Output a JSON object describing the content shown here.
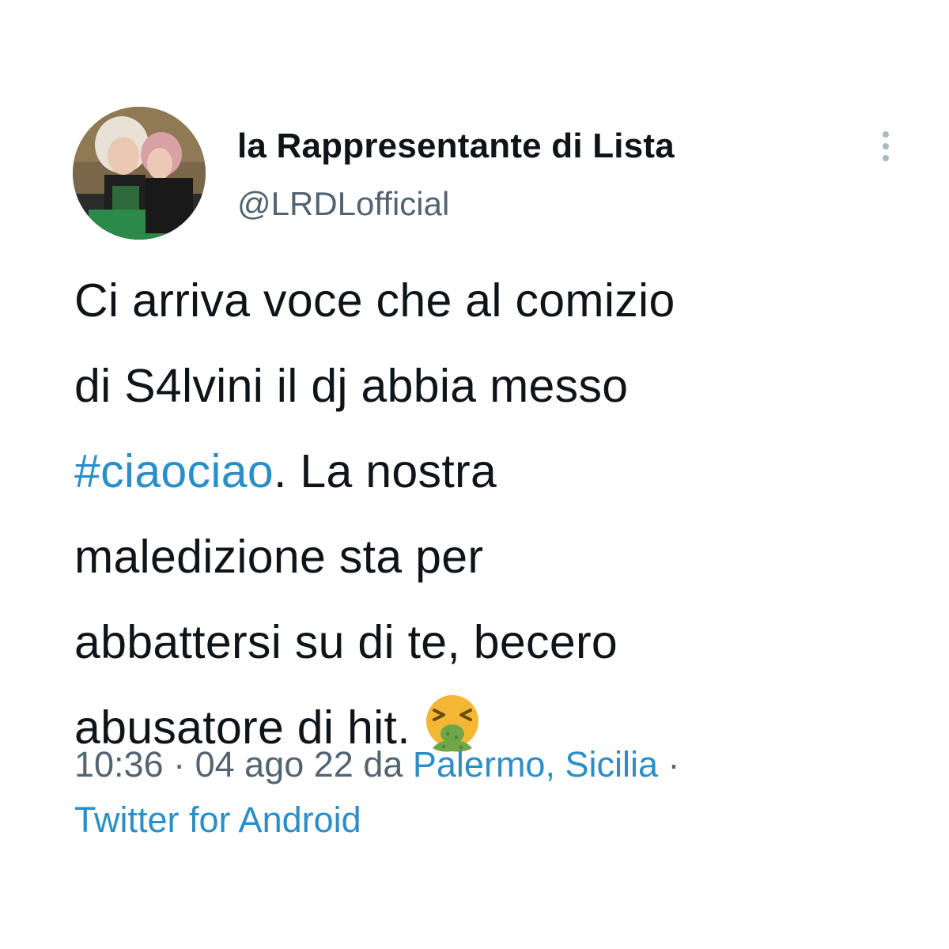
{
  "tweet": {
    "author": {
      "display_name": "la Rappresentante di Lista",
      "handle": "@LRDLofficial",
      "avatar_icon": "profile-photo"
    },
    "more_icon": "vertical-ellipsis-icon",
    "body": {
      "line1": "Ci arriva voce che al comizio",
      "line2": "di S4lvini il dj abbia messo",
      "hashtag": "#ciaociao",
      "line3_rest": ". La nostra",
      "line4": "maledizione sta per",
      "line5": "abbattersi su di te, becero",
      "line6": "abusatore di hit.",
      "emoji": "face-vomiting-emoji"
    },
    "meta": {
      "time": "10:36",
      "separator": " · ",
      "date": "04 ago 22",
      "from": " da ",
      "location": "Palermo, Sicilia",
      "separator_end": " ·",
      "source": "Twitter for Android"
    },
    "colors": {
      "link": "#2a8ec9",
      "secondary_text": "#536471",
      "primary_text": "#0f1419",
      "emoji_face": "#f4b733",
      "emoji_vomit": "#6fa64a"
    }
  }
}
